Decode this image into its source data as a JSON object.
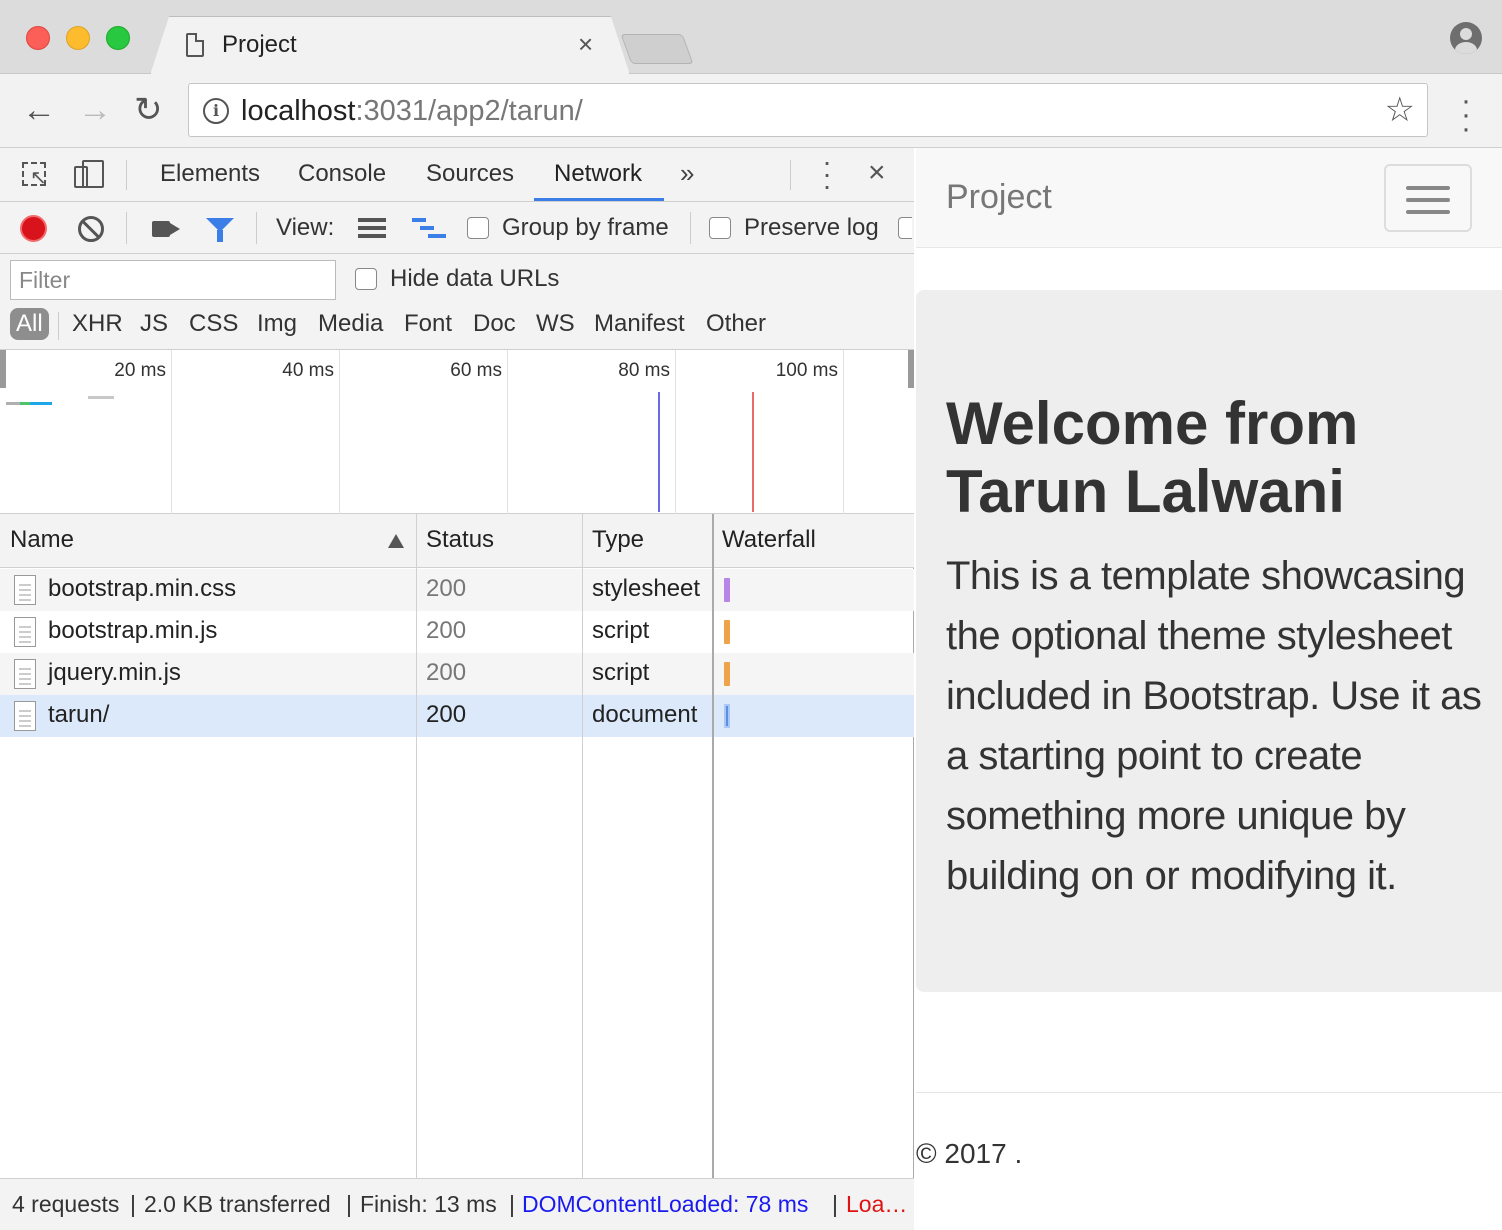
{
  "browser": {
    "tab_title": "Project",
    "tab_close": "×",
    "url_host": "localhost",
    "url_path": ":3031/app2/tarun/",
    "icons": [
      "back-icon",
      "forward-icon",
      "reload-icon",
      "info-icon",
      "star-icon",
      "menu-icon",
      "account-icon"
    ]
  },
  "devtools": {
    "tabs": [
      "Elements",
      "Console",
      "Sources",
      "Network"
    ],
    "active_tab": "Network",
    "more": "»",
    "close": "×",
    "view_label": "View:",
    "group_by_frame": "Group by frame",
    "preserve_log": "Preserve log",
    "filter_placeholder": "Filter",
    "hide_data_urls": "Hide data URLs",
    "type_filters": [
      "All",
      "XHR",
      "JS",
      "CSS",
      "Img",
      "Media",
      "Font",
      "Doc",
      "WS",
      "Manifest",
      "Other"
    ],
    "active_type_filter": "All",
    "overview_ticks": [
      "20 ms",
      "40 ms",
      "60 ms",
      "80 ms",
      "100 ms"
    ],
    "columns": {
      "name": "Name",
      "status": "Status",
      "type": "Type",
      "waterfall": "Waterfall"
    },
    "requests": [
      {
        "name": "bootstrap.min.css",
        "status": "200",
        "type": "stylesheet",
        "color": "#b784e8"
      },
      {
        "name": "bootstrap.min.js",
        "status": "200",
        "type": "script",
        "color": "#f0a24a"
      },
      {
        "name": "jquery.min.js",
        "status": "200",
        "type": "script",
        "color": "#f0a24a"
      },
      {
        "name": "tarun/",
        "status": "200",
        "type": "document",
        "color": "#5a8fe6"
      }
    ],
    "status": {
      "requests": "4 requests",
      "sep1": "|",
      "transferred": "2.0 KB transferred",
      "sep2": "|",
      "finish": "Finish: 13 ms",
      "sep3": "|",
      "dom_loaded": "DOMContentLoaded: 78 ms",
      "sep4": "|",
      "load": "Loa…"
    }
  },
  "page": {
    "brand": "Project",
    "jumbotron_title": "Welcome from Tarun Lalwani",
    "jumbotron_text": "This is a template showcasing the optional theme stylesheet included in Bootstrap. Use it as a starting point to create something more unique by building on or modifying it.",
    "footer": "© 2017 ."
  },
  "colors": {
    "accent": "#3b7ee8",
    "record": "#d8131b",
    "dom_loaded": "#1a1aee",
    "load": "#e01212"
  }
}
